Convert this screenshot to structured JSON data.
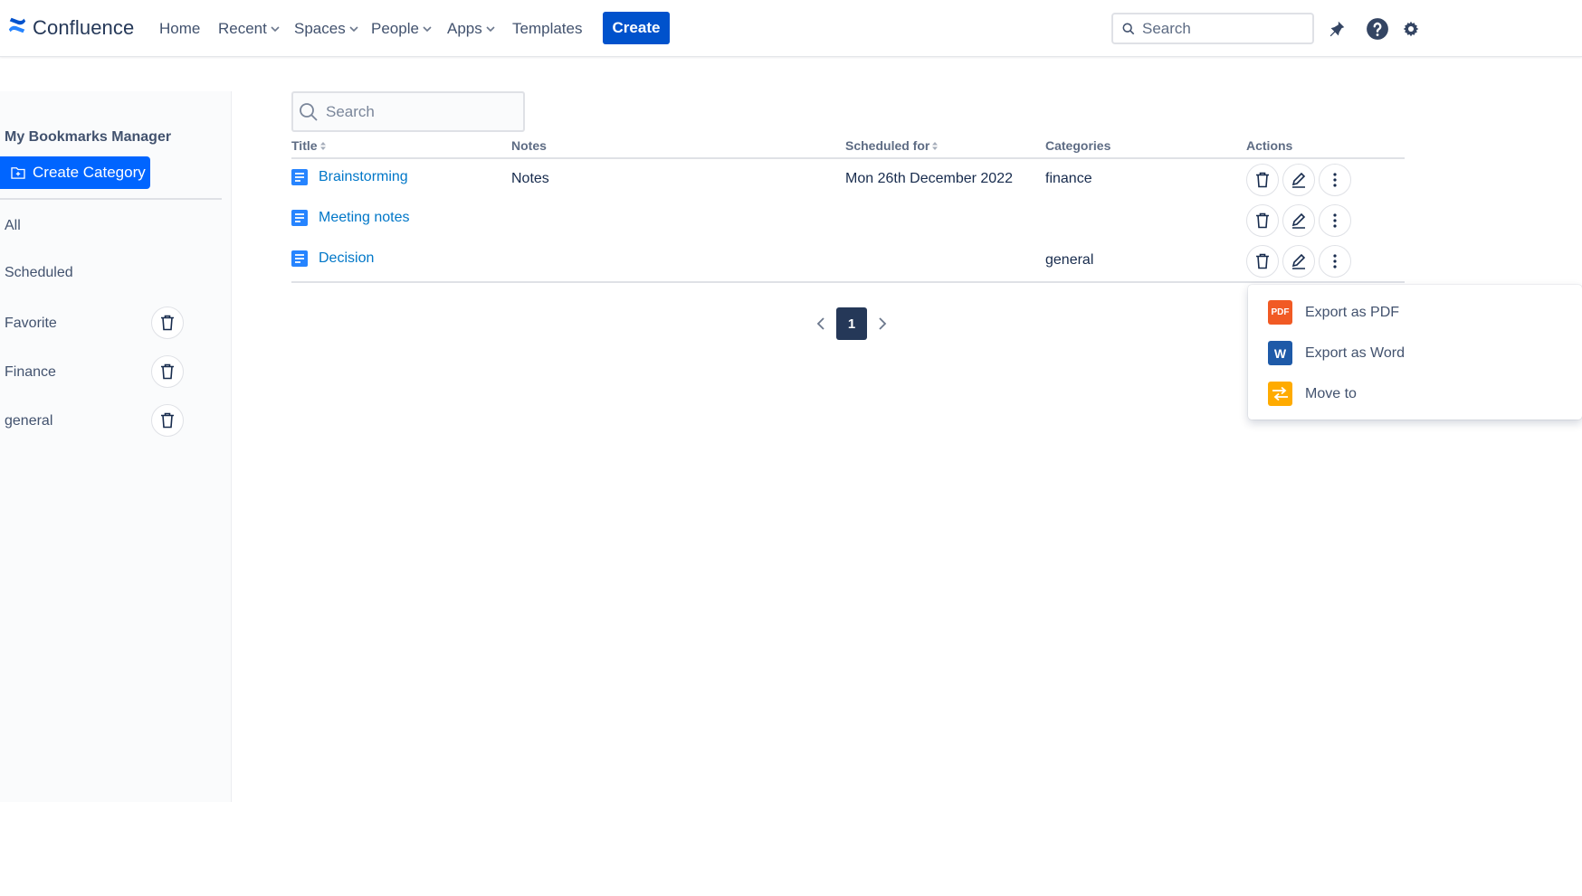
{
  "topnav": {
    "logo_text": "Confluence",
    "items": [
      {
        "label": "Home",
        "has_chevron": false
      },
      {
        "label": "Recent",
        "has_chevron": true
      },
      {
        "label": "Spaces",
        "has_chevron": true
      },
      {
        "label": "People",
        "has_chevron": true
      },
      {
        "label": "Apps",
        "has_chevron": true
      },
      {
        "label": "Templates",
        "has_chevron": false
      }
    ],
    "create_label": "Create",
    "search_placeholder": "Search",
    "icons": [
      "notification-icon",
      "help-icon",
      "settings-icon"
    ]
  },
  "sidebar": {
    "title": "My Bookmarks Manager",
    "create_category_label": "Create Category",
    "items": [
      {
        "label": "All",
        "deletable": false
      },
      {
        "label": "Scheduled",
        "deletable": false
      },
      {
        "label": "Favorite",
        "deletable": true
      },
      {
        "label": "Finance",
        "deletable": true
      },
      {
        "label": "general",
        "deletable": true
      }
    ]
  },
  "main": {
    "search_placeholder": "Search",
    "columns": {
      "title": "Title",
      "notes": "Notes",
      "scheduled_for": "Scheduled for",
      "categories": "Categories",
      "actions": "Actions"
    },
    "rows": [
      {
        "title": "Brainstorming",
        "notes": "Notes",
        "scheduled_for": "Mon 26th December 2022",
        "categories": "finance"
      },
      {
        "title": "Meeting notes",
        "notes": "",
        "scheduled_for": "",
        "categories": ""
      },
      {
        "title": "Decision",
        "notes": "",
        "scheduled_for": "",
        "categories": "general"
      }
    ],
    "pagination": {
      "current_page": "1"
    }
  },
  "dropdown_menu": {
    "items": [
      {
        "label": "Export as PDF",
        "icon": "pdf-icon",
        "icon_text": "PDF",
        "color": "#f15a24"
      },
      {
        "label": "Export as Word",
        "icon": "word-icon",
        "icon_text": "W",
        "color": "#1e5aa8"
      },
      {
        "label": "Move to",
        "icon": "move-icon",
        "icon_text": "",
        "color": "#ffab00"
      }
    ]
  },
  "colors": {
    "brand": "#0052cc",
    "create_category": "#0065ff",
    "link": "#0077c8",
    "pager_active": "#253858"
  }
}
